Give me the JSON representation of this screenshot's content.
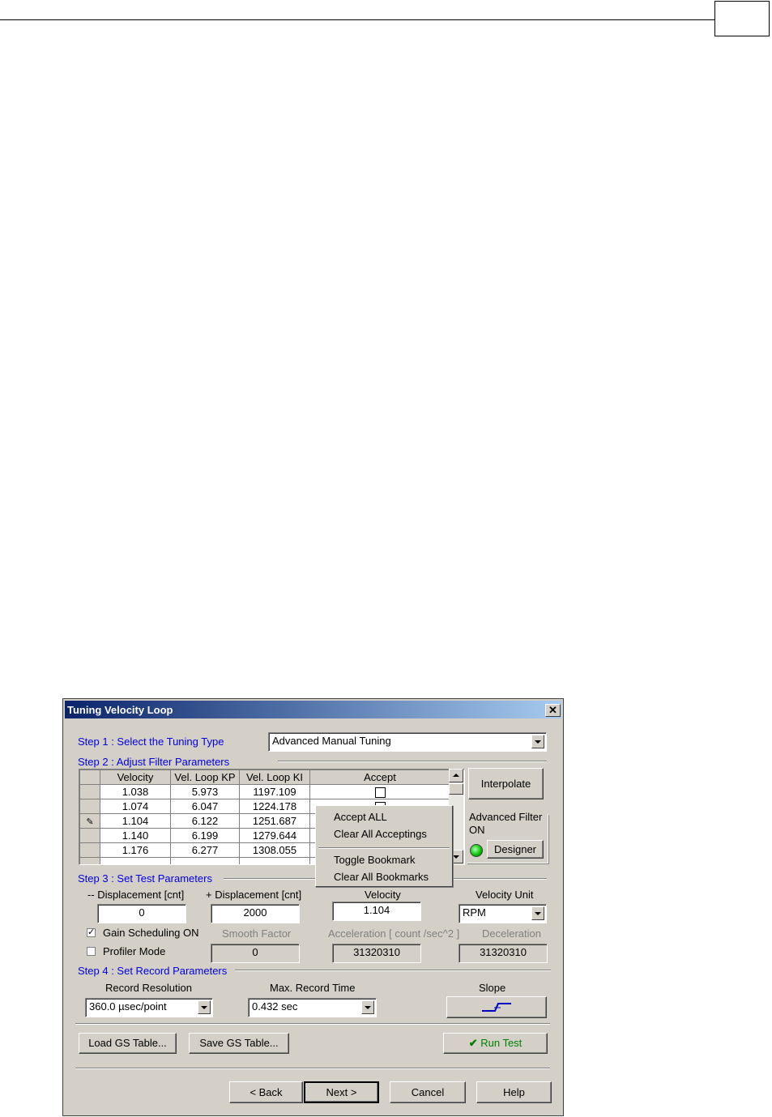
{
  "dialog": {
    "title": "Tuning Velocity Loop",
    "close_label": "✕",
    "step1": {
      "label": "Step 1 : Select the  Tuning Type",
      "tuning_type": "Advanced Manual Tuning"
    },
    "step2": {
      "label": "Step 2 :  Adjust Filter Parameters",
      "columns": [
        "Velocity",
        "Vel. Loop KP",
        "Vel. Loop KI",
        "Accept"
      ],
      "rows": [
        {
          "velocity": "1.038",
          "kp": "5.973",
          "ki": "1197.109"
        },
        {
          "velocity": "1.074",
          "kp": "6.047",
          "ki": "1224.178"
        },
        {
          "velocity": "1.104",
          "kp": "6.122",
          "ki": "1251.687"
        },
        {
          "velocity": "1.140",
          "kp": "6.199",
          "ki": "1279.644"
        },
        {
          "velocity": "1.176",
          "kp": "6.277",
          "ki": "1308.055"
        }
      ],
      "interpolate_label": "Interpolate",
      "advanced_filter_label": "Advanced Filter",
      "advanced_filter_state": "ON",
      "designer_label": "Designer",
      "context_menu": [
        "Accept ALL",
        "Clear All Acceptings",
        "Toggle Bookmark",
        "Clear All Bookmarks"
      ]
    },
    "step3": {
      "label": "Step 3 : Set Test  Parameters",
      "neg_disp_label": "-- Displacement [cnt]",
      "neg_disp_value": "0",
      "pos_disp_label": "+ Displacement [cnt]",
      "pos_disp_value": "2000",
      "velocity_label": "Velocity",
      "velocity_value": "1.104",
      "velocity_unit_label": "Velocity Unit",
      "velocity_unit_value": "RPM",
      "gain_scheduling_label": "Gain Scheduling ON",
      "gain_scheduling_checked": true,
      "profiler_mode_label": "Profiler Mode",
      "profiler_mode_checked": false,
      "smooth_factor_label": "Smooth Factor",
      "smooth_factor_value": "0",
      "acceleration_label": "Acceleration   [ count /sec^2 ]",
      "acceleration_value": "31320310",
      "deceleration_label": "Deceleration",
      "deceleration_value": "31320310"
    },
    "step4": {
      "label": "Step 4 : Set Record Parameters",
      "resolution_label": "Record Resolution",
      "resolution_value": "360.0 µsec/point",
      "max_time_label": "Max. Record Time",
      "max_time_value": "0.432 sec",
      "slope_label": "Slope"
    },
    "buttons": {
      "load_gs": "Load GS Table...",
      "save_gs": "Save GS Table...",
      "run_test": "Run Test",
      "back": "< Back",
      "next": "Next >",
      "cancel": "Cancel",
      "help": "Help"
    }
  },
  "colors": {
    "title_start": "#0a246a",
    "title_end": "#a6caf0",
    "step_text": "#0000e0",
    "run_test_text": "#008000"
  }
}
